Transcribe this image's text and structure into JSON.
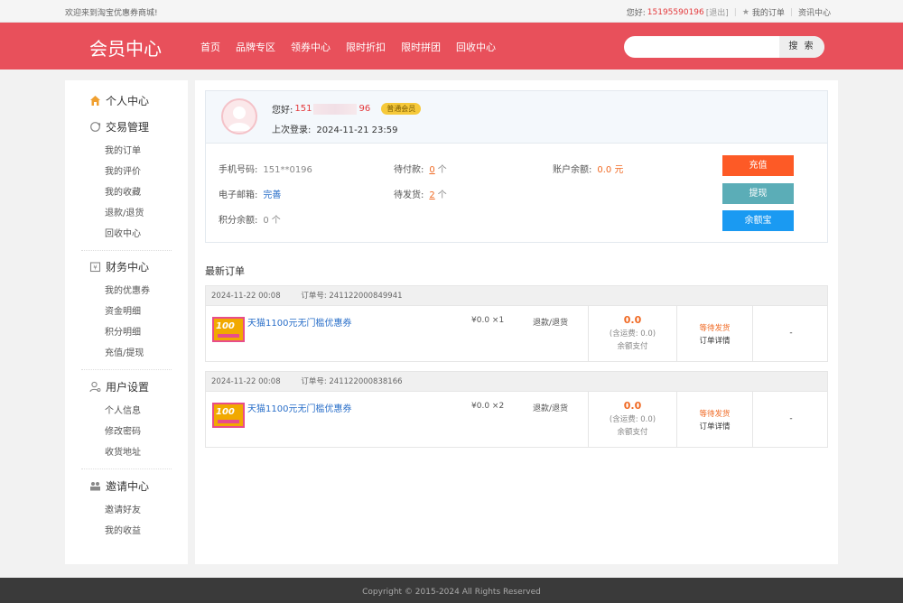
{
  "topbar": {
    "welcome": "欢迎来到淘宝优惠券商城!",
    "greeting": "您好:",
    "phone": "15195590196",
    "logout": "[退出]",
    "my_orders": "我的订单",
    "news": "资讯中心"
  },
  "header": {
    "logo": "会员中心",
    "nav": [
      "首页",
      "品牌专区",
      "领券中心",
      "限时折扣",
      "限时拼团",
      "回收中心"
    ],
    "search_placeholder": "",
    "search_button": "搜 索"
  },
  "sidebar": {
    "groups": [
      {
        "title": "个人中心",
        "icon": "home-icon",
        "items": []
      },
      {
        "title": "交易管理",
        "icon": "refresh-icon",
        "items": [
          "我的订单",
          "我的评价",
          "我的收藏",
          "退款/退货",
          "回收中心"
        ]
      },
      {
        "title": "财务中心",
        "icon": "wallet-icon",
        "items": [
          "我的优惠券",
          "资金明细",
          "积分明细",
          "充值/提现"
        ]
      },
      {
        "title": "用户设置",
        "icon": "user-icon",
        "items": [
          "个人信息",
          "修改密码",
          "收货地址"
        ]
      },
      {
        "title": "邀请中心",
        "icon": "group-icon",
        "items": [
          "邀请好友",
          "我的收益"
        ]
      }
    ]
  },
  "profile": {
    "hello_label": "您好:",
    "name_start": "151",
    "name_end": "96",
    "level": "普通会员",
    "last_login_label": "上次登录:",
    "last_login": "2024-11-21 23:59",
    "phone_label": "手机号码:",
    "phone_value": "151**0196",
    "email_label": "电子邮箱:",
    "email_value": "完善",
    "points_label": "积分余额:",
    "points_value": "0",
    "points_unit": "个",
    "pending_pay_label": "待付款:",
    "pending_pay_value": "0",
    "pending_pay_unit": "个",
    "pending_ship_label": "待发货:",
    "pending_ship_value": "2",
    "pending_ship_unit": "个",
    "balance_label": "账户余额:",
    "balance_value": "0.0 元",
    "btn_recharge": "充值",
    "btn_withdraw": "提现",
    "btn_yuebao": "余额宝"
  },
  "orders_title": "最新订单",
  "orders": [
    {
      "date": "2024-11-22 00:08",
      "order_no_label": "订单号:",
      "order_no": "241122000849941",
      "product": "天猫1100元无门槛优惠券",
      "price_qty": "¥0.0 ×1",
      "refund": "退款/退货",
      "total": "0.0",
      "shipping": "(含运费: 0.0)",
      "pay_method": "余额支付",
      "status": "等待发货",
      "detail": "订单详情",
      "extra": "-"
    },
    {
      "date": "2024-11-22 00:08",
      "order_no_label": "订单号:",
      "order_no": "241122000838166",
      "product": "天猫1100元无门槛优惠券",
      "price_qty": "¥0.0 ×2",
      "refund": "退款/退货",
      "total": "0.0",
      "shipping": "(含运费: 0.0)",
      "pay_method": "余额支付",
      "status": "等待发货",
      "detail": "订单详情",
      "extra": "-"
    }
  ],
  "thumb_text": "100",
  "footer": "Copyright © 2015-2024 All Rights Reserved",
  "colors": {
    "header_bg": "#e8505b",
    "accent_red": "#e4393c",
    "orange": "#f06a24",
    "recharge": "#fd5a26",
    "withdraw": "#5badb7",
    "yuebao": "#1a9af2",
    "link": "#2a6fc9"
  }
}
